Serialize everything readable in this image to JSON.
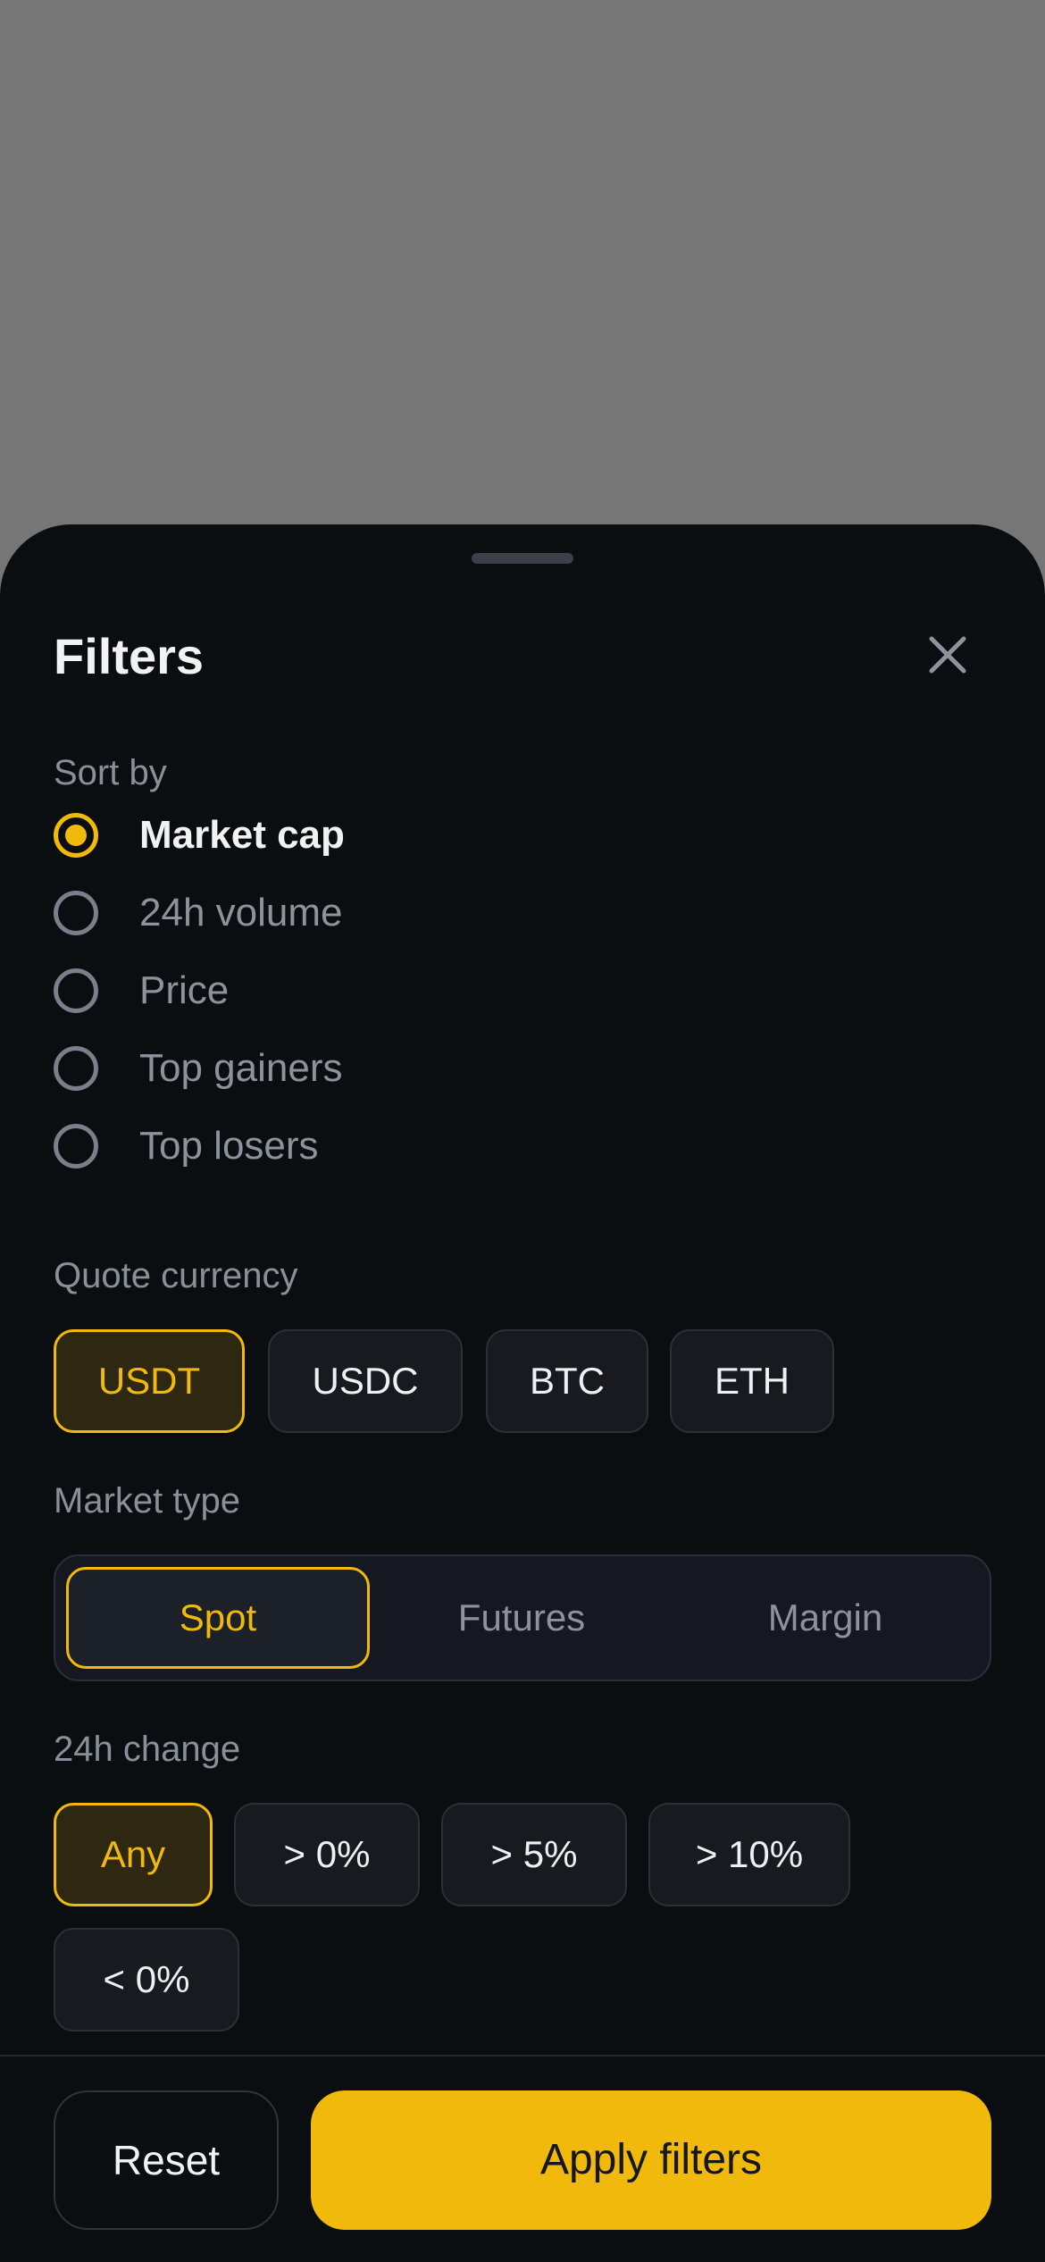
{
  "sheet": {
    "title": "Filters",
    "close_icon": "close-icon"
  },
  "sort_by": {
    "label": "Sort by",
    "options": [
      {
        "label": "Market cap",
        "selected": true
      },
      {
        "label": "24h volume",
        "selected": false
      },
      {
        "label": "Price",
        "selected": false
      },
      {
        "label": "Top gainers",
        "selected": false
      },
      {
        "label": "Top losers",
        "selected": false
      }
    ]
  },
  "quote_currency": {
    "label": "Quote currency",
    "options": [
      {
        "label": "USDT",
        "selected": true
      },
      {
        "label": "USDC",
        "selected": false
      },
      {
        "label": "BTC",
        "selected": false
      },
      {
        "label": "ETH",
        "selected": false
      }
    ]
  },
  "market_type": {
    "label": "Market type",
    "options": [
      {
        "label": "Spot",
        "selected": true
      },
      {
        "label": "Futures",
        "selected": false
      },
      {
        "label": "Margin",
        "selected": false
      }
    ]
  },
  "change_24h": {
    "label": "24h change",
    "options": [
      {
        "label": "Any",
        "selected": true
      },
      {
        "label": "> 0%",
        "selected": false
      },
      {
        "label": "> 5%",
        "selected": false
      },
      {
        "label": "> 10%",
        "selected": false
      },
      {
        "label": "< 0%",
        "selected": false
      }
    ]
  },
  "footer": {
    "reset_label": "Reset",
    "apply_label": "Apply filters"
  },
  "colors": {
    "accent": "#f0b90b",
    "sheet_bg": "#0b0e11",
    "overlay": "#767676"
  }
}
